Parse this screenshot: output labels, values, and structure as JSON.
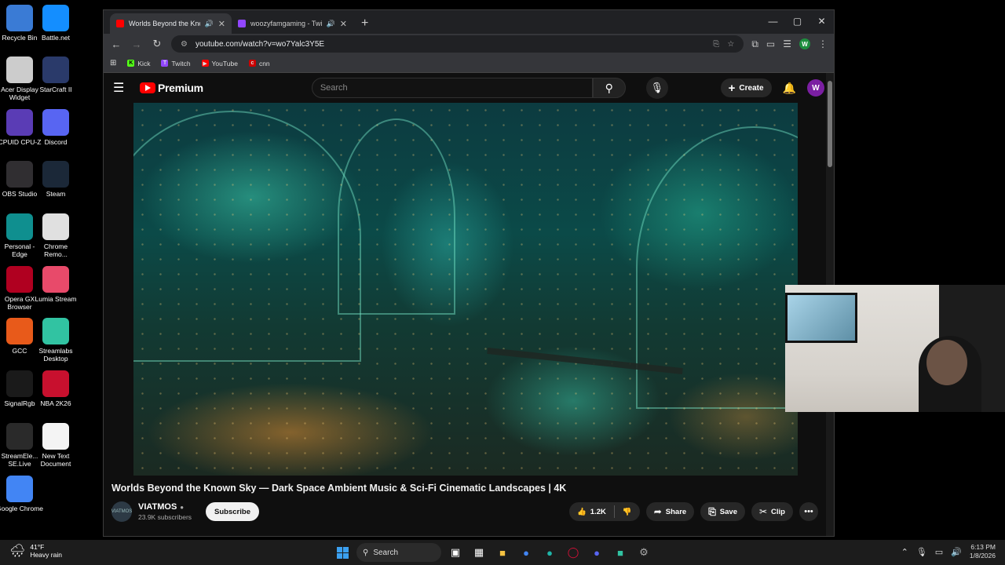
{
  "desktop_icons": [
    {
      "label": "Recycle Bin",
      "color": "#3a7bd5"
    },
    {
      "label": "Battle.net",
      "color": "#148eff"
    },
    {
      "label": "Acer Display Widget",
      "color": "#cccccc"
    },
    {
      "label": "StarCraft II",
      "color": "#2a3a6a"
    },
    {
      "label": "CPUID CPU-Z",
      "color": "#5a3cb5"
    },
    {
      "label": "Discord",
      "color": "#5865f2"
    },
    {
      "label": "OBS Studio",
      "color": "#302e31"
    },
    {
      "label": "Steam",
      "color": "#1b2838"
    },
    {
      "label": "Personal - Edge",
      "color": "#0f8f8f"
    },
    {
      "label": "Chrome Remo...",
      "color": "#e0e0e0"
    },
    {
      "label": "Opera GX Browser",
      "color": "#b00020"
    },
    {
      "label": "Lumia Stream",
      "color": "#e84a6a"
    },
    {
      "label": "GCC",
      "color": "#e85a1a"
    },
    {
      "label": "Streamlabs Desktop",
      "color": "#31c3a2"
    },
    {
      "label": "SignalRgb",
      "color": "#1a1a1a"
    },
    {
      "label": "NBA 2K26",
      "color": "#c8102e"
    },
    {
      "label": "StreamEle... SE.Live",
      "color": "#2a2a2a"
    },
    {
      "label": "New Text Document",
      "color": "#f4f4f4"
    },
    {
      "label": "Google Chrome",
      "color": "#4285f4"
    }
  ],
  "browser": {
    "tabs": [
      {
        "title": "Worlds Beyond the Known",
        "favicon_color": "#ff0000",
        "active": true
      },
      {
        "title": "woozyfamgaming - Twitch",
        "favicon_color": "#9146ff",
        "active": false
      }
    ],
    "url": "youtube.com/watch?v=wo7Yalc3Y5E",
    "profile_initial": "W",
    "bookmarks": [
      {
        "label": "Kick",
        "color": "#53fc18",
        "glyph": "K"
      },
      {
        "label": "Twitch",
        "color": "#9146ff",
        "glyph": "T"
      },
      {
        "label": "YouTube",
        "color": "#ff0000",
        "glyph": "▶"
      },
      {
        "label": "cnn",
        "color": "#cc0000",
        "glyph": "c"
      }
    ]
  },
  "youtube": {
    "logo_text": "Premium",
    "search_placeholder": "Search",
    "create_label": "Create",
    "avatar_initial": "W",
    "video_title": "Worlds Beyond the Known Sky — Dark Space Ambient Music & Sci-Fi Cinematic Landscapes | 4K",
    "channel_name": "VIATMOS",
    "channel_avatar_text": "VIATMOS",
    "subscribers": "23.9K subscribers",
    "subscribe_label": "Subscribe",
    "like_count": "1.2K",
    "share_label": "Share",
    "save_label": "Save",
    "clip_label": "Clip"
  },
  "taskbar": {
    "weather_temp": "41°F",
    "weather_desc": "Heavy rain",
    "search_label": "Search",
    "time": "6:13 PM",
    "date": "1/8/2026"
  },
  "icons": {
    "back": "back-icon",
    "forward": "forward-icon",
    "reload": "reload-icon",
    "search": "search-icon",
    "mic": "microphone-icon",
    "bell": "notification-bell-icon"
  }
}
